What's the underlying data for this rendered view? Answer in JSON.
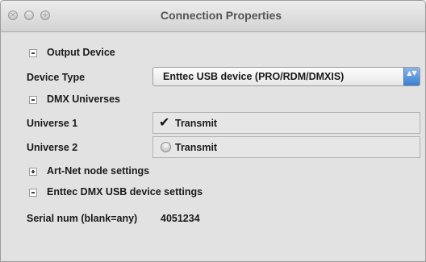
{
  "window": {
    "title": "Connection Properties"
  },
  "sections": {
    "output_device": "Output Device",
    "dmx_universes": "DMX Universes",
    "artnet": "Art-Net node settings",
    "enttec": "Enttec DMX USB device settings"
  },
  "device_type": {
    "label": "Device Type",
    "value": "Enttec USB device (PRO/RDM/DMXIS)",
    "arrow_glyph": "▲▼"
  },
  "universes": [
    {
      "label": "Universe 1",
      "checkbox_label": "Transmit",
      "checked": true,
      "glyph": "✔"
    },
    {
      "label": "Universe 2",
      "checkbox_label": "Transmit",
      "checked": false
    }
  ],
  "serial": {
    "label": "Serial num (blank=any)",
    "value": "4051234"
  },
  "traffic_lights": {
    "close": "×",
    "minimize": "–",
    "zoom": "+"
  }
}
